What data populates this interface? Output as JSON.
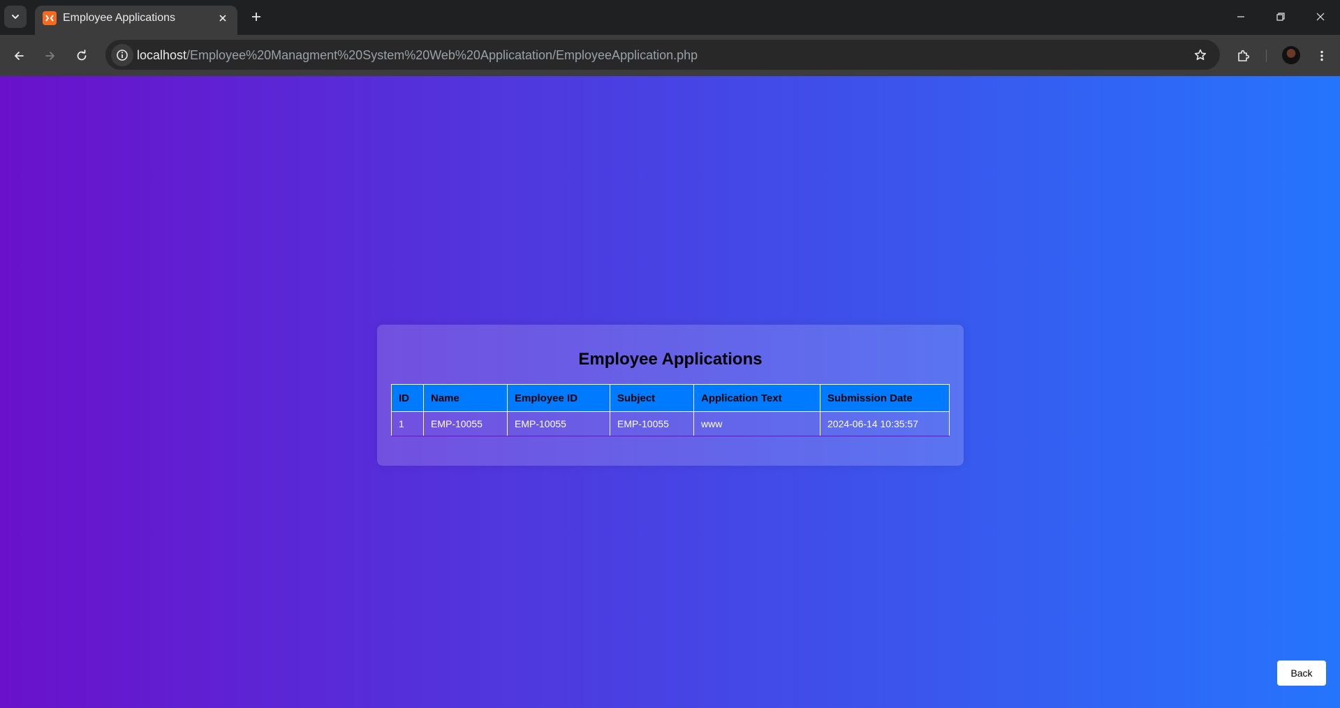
{
  "browser": {
    "tab_title": "Employee Applications",
    "url_host": "localhost",
    "url_path": "/Employee%20Managment%20System%20Web%20Applicatation/EmployeeApplication.php"
  },
  "page": {
    "title": "Employee Applications",
    "table": {
      "headers": [
        "ID",
        "Name",
        "Employee ID",
        "Subject",
        "Application Text",
        "Submission Date"
      ],
      "rows": [
        [
          "1",
          "EMP-10055",
          "EMP-10055",
          "EMP-10055",
          "www",
          "2024-06-14 10:35:57"
        ]
      ]
    },
    "back_label": "Back"
  },
  "colors": {
    "gradient_start": "#6a11cb",
    "gradient_end": "#2575fc",
    "table_header": "#007bff"
  }
}
